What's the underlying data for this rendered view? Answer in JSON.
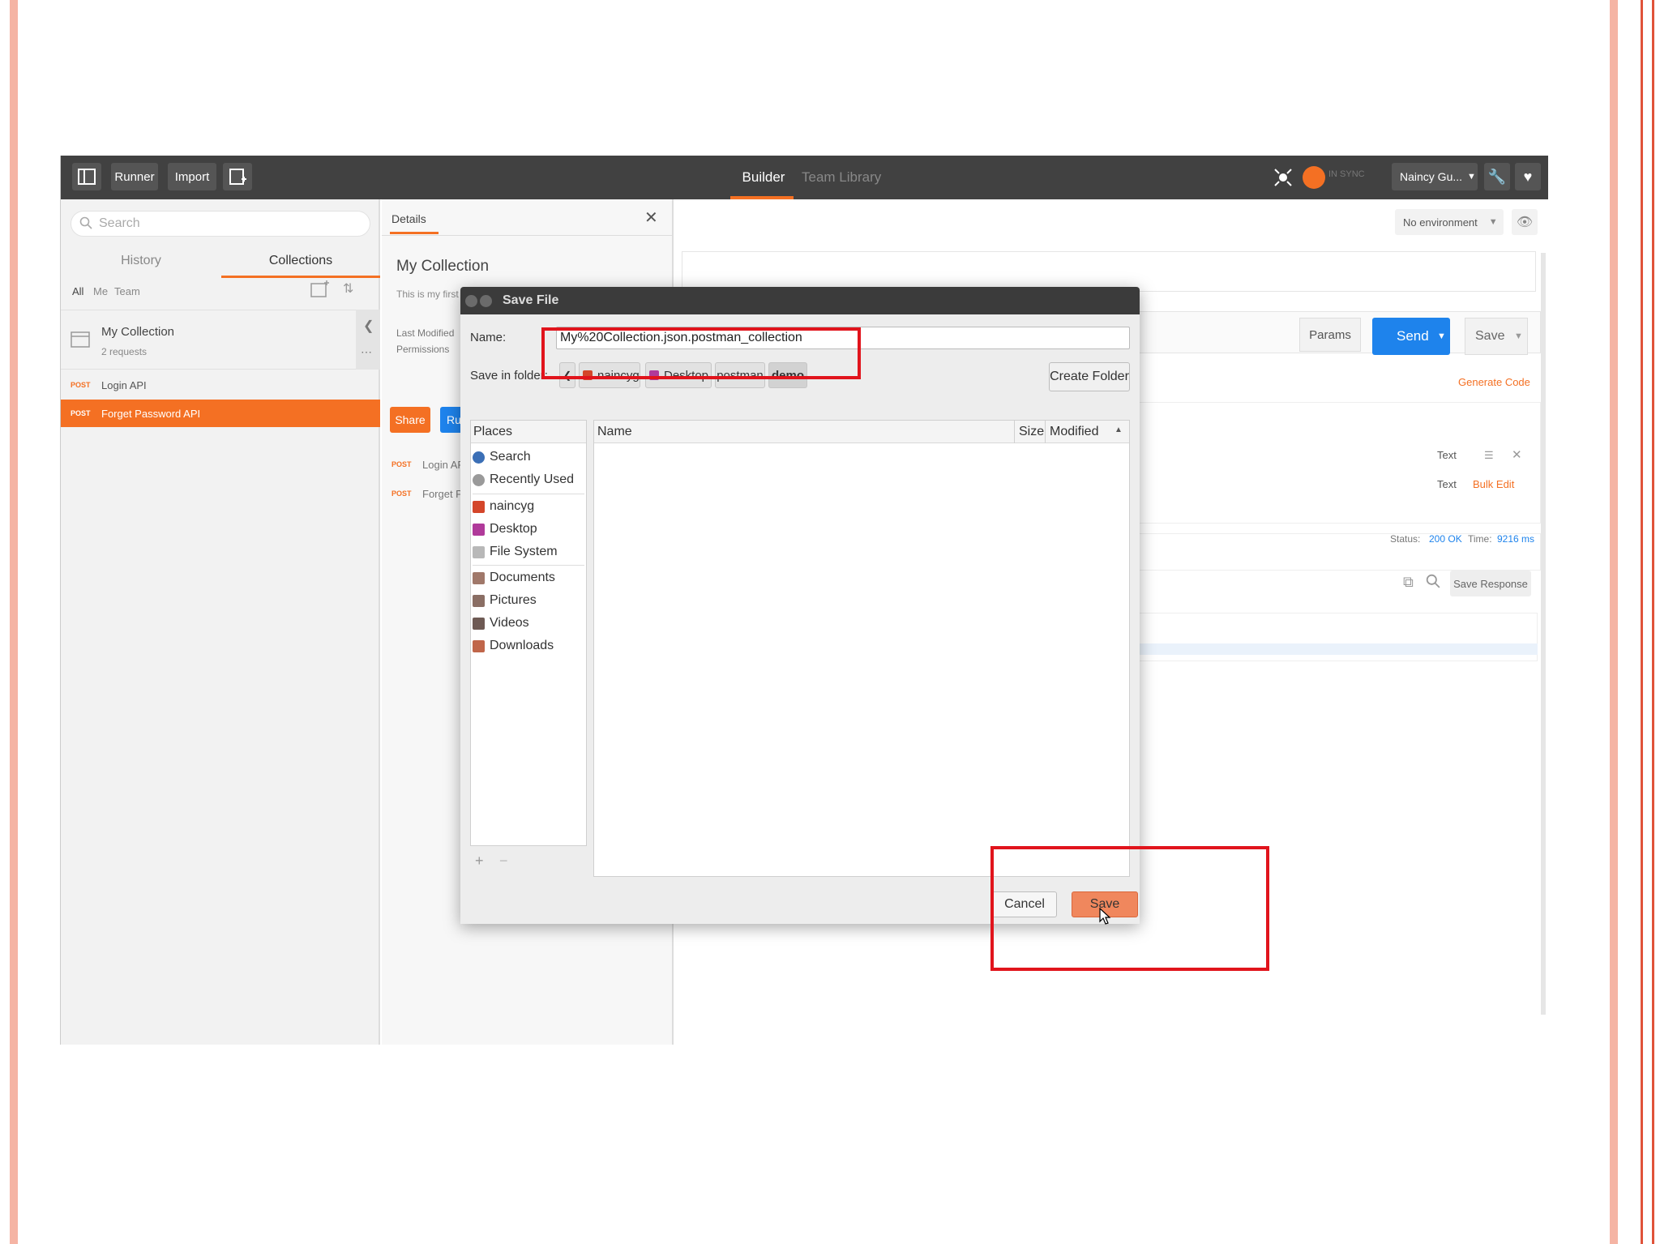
{
  "topbar": {
    "runner_label": "Runner",
    "import_label": "Import",
    "builder_tab": "Builder",
    "team_library_tab": "Team Library",
    "sync_status": "IN SYNC",
    "user_name": "Naincy Gu...",
    "accent_color": "#f47023"
  },
  "sidebar": {
    "search_placeholder": "Search",
    "tab_history": "History",
    "tab_collections": "Collections",
    "filters": [
      "All",
      "Me",
      "Team"
    ],
    "collection_name": "My Collection",
    "collection_count": "2 requests",
    "requests": [
      {
        "method": "POST",
        "name": "Login API"
      },
      {
        "method": "POST",
        "name": "Forget Password API"
      }
    ]
  },
  "details": {
    "tab_label": "Details",
    "title": "My Collection",
    "description": "This is my first C",
    "last_modified_label": "Last Modified",
    "permissions_label": "Permissions",
    "share_label": "Share",
    "run_label": "Run",
    "requests": [
      {
        "method": "POST",
        "name": "Login API"
      },
      {
        "method": "POST",
        "name": "Forget Pa"
      }
    ]
  },
  "main": {
    "environment": "No environment",
    "params_label": "Params",
    "send_label": "Send",
    "save_label": "Save",
    "generate_code": "Generate Code",
    "text_dropdown_1": "Text",
    "text_dropdown_2": "Text",
    "bulk_edit": "Bulk Edit",
    "status_label": "Status:",
    "status_value": "200 OK",
    "time_label": "Time:",
    "time_value": "9216 ms",
    "save_response": "Save Response",
    "send_color": "#1e83ec"
  },
  "dialog": {
    "title": "Save File",
    "name_label": "Name:",
    "name_value": "My%20Collection.json.postman_collection",
    "save_in_folder_label": "Save in folder:",
    "breadcrumbs": [
      "naincyg",
      "Desktop",
      "postman",
      "demo"
    ],
    "create_folder_label": "Create Folder",
    "places_header": "Places",
    "places": [
      "Search",
      "Recently Used",
      "naincyg",
      "Desktop",
      "File System",
      "Documents",
      "Pictures",
      "Videos",
      "Downloads"
    ],
    "columns": [
      "Name",
      "Size",
      "Modified"
    ],
    "cancel_label": "Cancel",
    "save_label": "Save",
    "save_color": "#f0875d",
    "highlight_color": "#e1141c"
  }
}
